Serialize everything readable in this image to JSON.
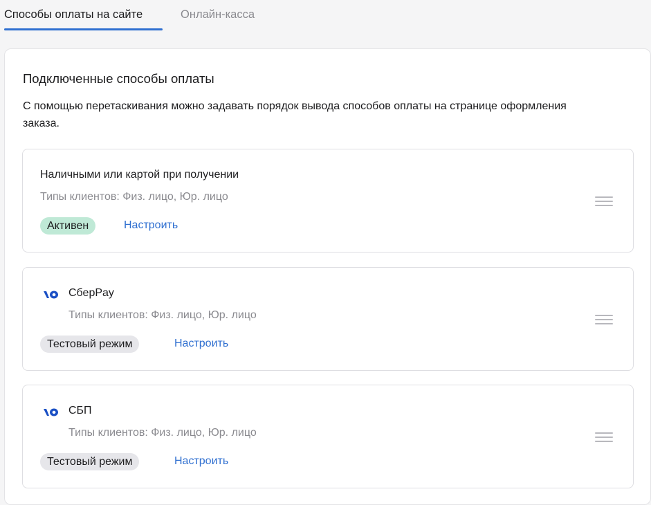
{
  "tabs": [
    {
      "label": "Способы оплаты на сайте",
      "active": true
    },
    {
      "label": "Онлайн-касса",
      "active": false
    }
  ],
  "panel": {
    "title": "Подключенные способы оплаты",
    "description": "С помощью перетаскивания можно задавать порядок вывода способов оплаты на странице оформления заказа."
  },
  "methods": [
    {
      "name": "Наличными или картой при получении",
      "clients": "Типы клиентов: Физ. лицо, Юр. лицо",
      "status": "Активен",
      "action": "Настроить",
      "icon": null
    },
    {
      "name": "СберPay",
      "clients": "Типы клиентов: Физ. лицо, Юр. лицо",
      "status": "Тестовый режим",
      "action": "Настроить",
      "icon": "yoomoney-logo-icon"
    },
    {
      "name": "СБП",
      "clients": "Типы клиентов: Физ. лицо, Юр. лицо",
      "status": "Тестовый режим",
      "action": "Настроить",
      "icon": "yoomoney-logo-icon"
    }
  ],
  "colors": {
    "accent": "#2f6fd0",
    "active_badge": "#bfe9d6",
    "test_badge": "#e6e6ea",
    "logo": "#1a4fc4"
  }
}
